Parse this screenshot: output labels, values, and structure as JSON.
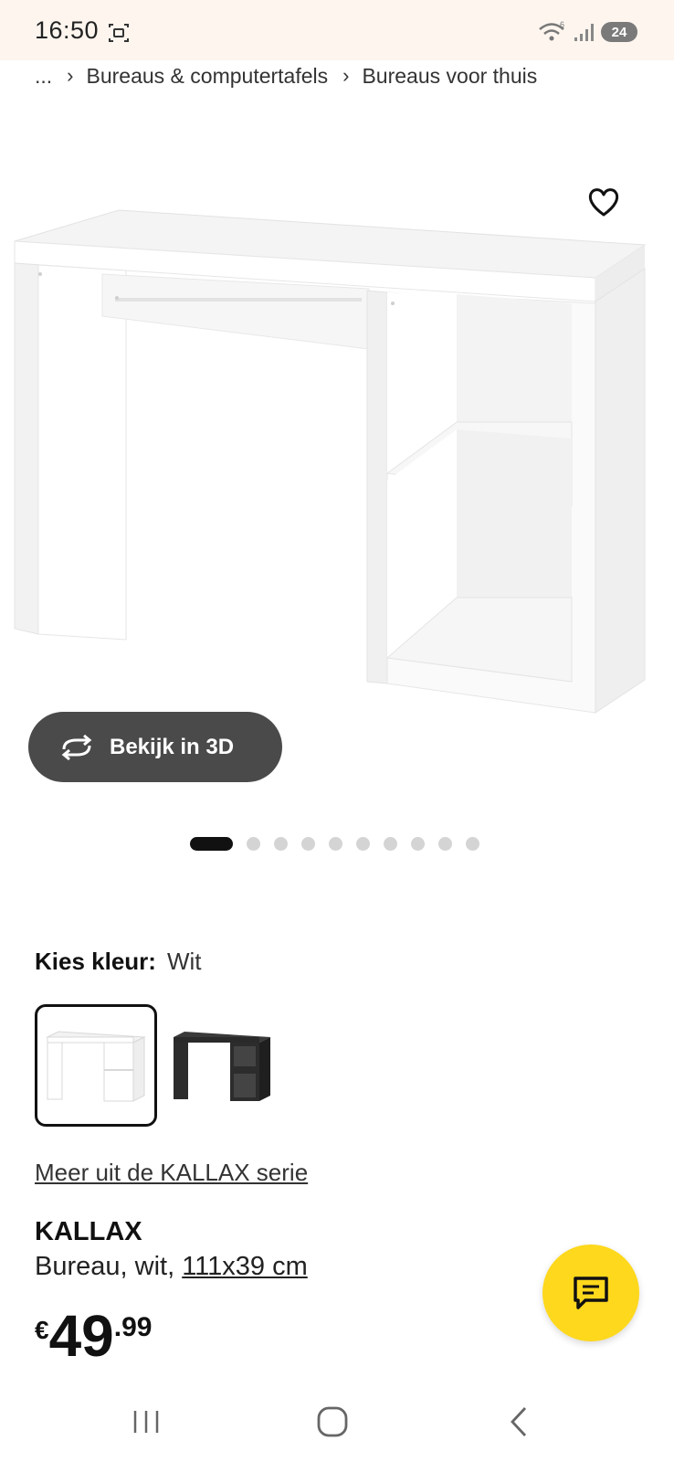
{
  "status_bar": {
    "time": "16:50",
    "battery": "24",
    "icons": [
      "screen-record-icon",
      "wifi-icon",
      "signal-icon",
      "battery-icon"
    ]
  },
  "breadcrumb": {
    "ellipsis": "...",
    "items": [
      "Bureaus & computertafels",
      "Bureaus voor thuis"
    ]
  },
  "gallery": {
    "view3d_label": "Bekijk in 3D",
    "dot_count": 10,
    "active_index": 0
  },
  "color": {
    "label": "Kies kleur:",
    "selected": "Wit",
    "options": [
      "white",
      "black"
    ]
  },
  "series_link": "Meer uit de KALLAX serie",
  "product": {
    "name": "KALLAX",
    "description": "Bureau, wit,",
    "dimensions": "111x39 cm"
  },
  "price": {
    "currency": "€",
    "integer": "49",
    "decimal": ".99"
  },
  "colors": {
    "accent": "#fdd81d",
    "button_dark": "#4a4a4a",
    "status_bg": "#fdf5ee"
  }
}
